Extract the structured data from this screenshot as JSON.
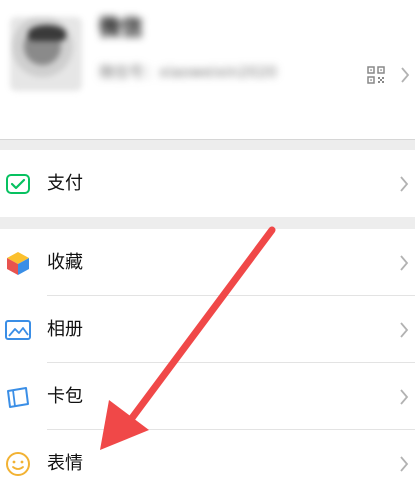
{
  "profile": {
    "nickname": "微信",
    "wechat_id": "微信号：xiaoweixin2020"
  },
  "menu": {
    "items": [
      {
        "label": "支付",
        "icon": "pay-icon"
      },
      {
        "label": "收藏",
        "icon": "favorites-icon"
      },
      {
        "label": "相册",
        "icon": "album-icon"
      },
      {
        "label": "卡包",
        "icon": "card-icon"
      },
      {
        "label": "表情",
        "icon": "sticker-icon"
      }
    ]
  },
  "colors": {
    "background": "#ededed",
    "pay_green": "#07c160",
    "annotation_red": "#f04848",
    "album_blue": "#3a8ee6"
  }
}
